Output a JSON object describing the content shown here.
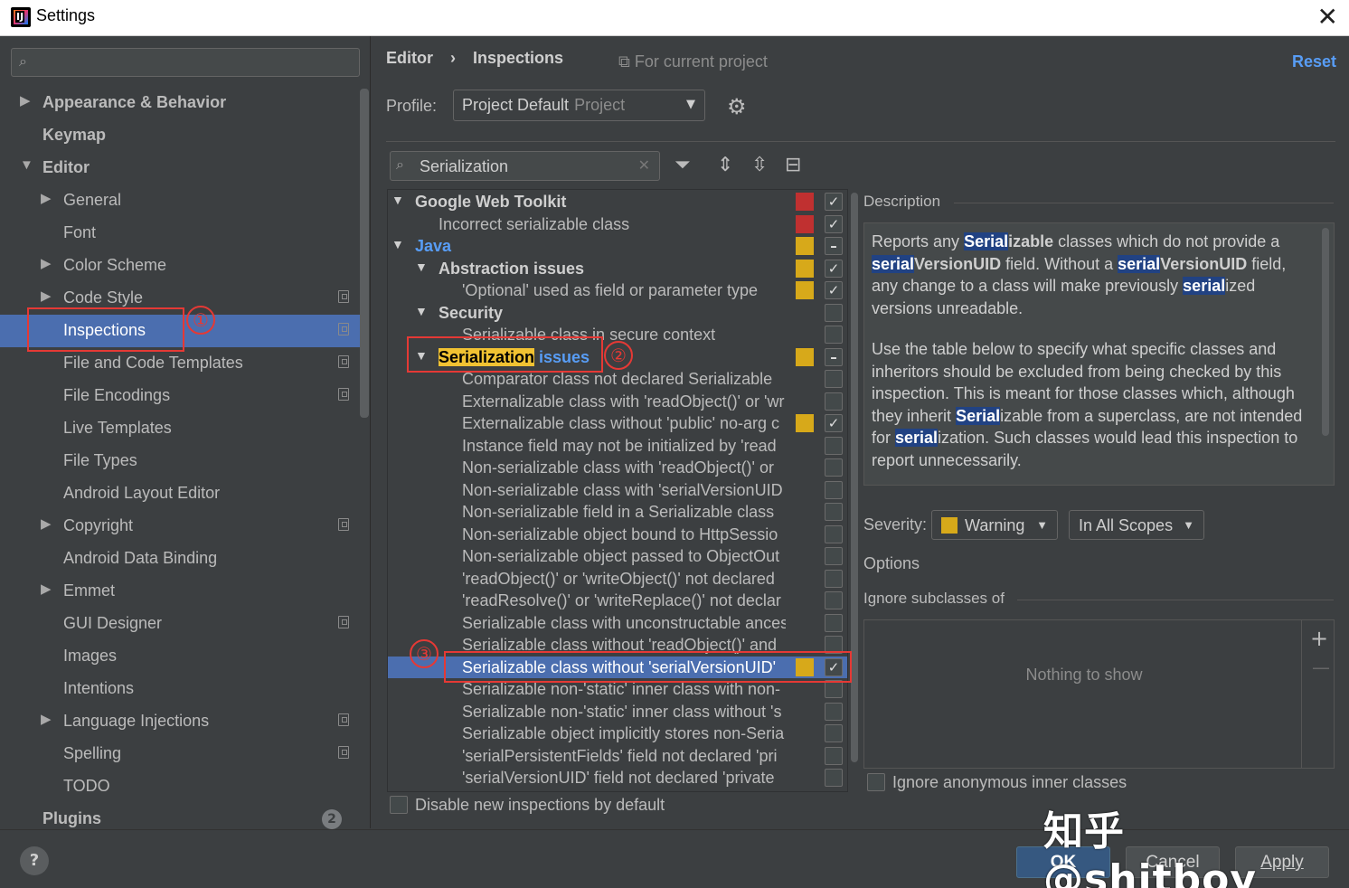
{
  "window": {
    "title": "Settings",
    "close_glyph": "✕"
  },
  "sidebar": {
    "search_placeholder": "",
    "items": [
      {
        "label": "Appearance & Behavior",
        "expanded": false,
        "bold": true
      },
      {
        "label": "Keymap",
        "bold": true
      },
      {
        "label": "Editor",
        "expanded": true,
        "bold": true
      },
      {
        "label": "General",
        "expanded": false
      },
      {
        "label": "Font"
      },
      {
        "label": "Color Scheme",
        "expanded": false
      },
      {
        "label": "Code Style",
        "expanded": false,
        "project_icon": true
      },
      {
        "label": "Inspections",
        "selected": true,
        "project_icon": true
      },
      {
        "label": "File and Code Templates",
        "project_icon": true
      },
      {
        "label": "File Encodings",
        "project_icon": true
      },
      {
        "label": "Live Templates"
      },
      {
        "label": "File Types"
      },
      {
        "label": "Android Layout Editor"
      },
      {
        "label": "Copyright",
        "expanded": false,
        "project_icon": true
      },
      {
        "label": "Android Data Binding"
      },
      {
        "label": "Emmet",
        "expanded": false
      },
      {
        "label": "GUI Designer",
        "project_icon": true
      },
      {
        "label": "Images"
      },
      {
        "label": "Intentions"
      },
      {
        "label": "Language Injections",
        "expanded": false,
        "project_icon": true
      },
      {
        "label": "Spelling",
        "project_icon": true
      },
      {
        "label": "TODO"
      },
      {
        "label": "Plugins",
        "bold": true,
        "badge": "2"
      }
    ]
  },
  "header": {
    "breadcrumb": [
      "Editor",
      "Inspections"
    ],
    "breadcrumb_sep": "›",
    "scope_note": "For current project",
    "reset": "Reset",
    "profile_label": "Profile:",
    "profile_value": "Project Default",
    "profile_kind": "Project"
  },
  "inspection_search": {
    "value": "Serialization"
  },
  "annotations": {
    "circle1": "①",
    "circle2": "②",
    "circle3": "③"
  },
  "tree": [
    {
      "label": "Google Web Toolkit",
      "level": 0,
      "group": true,
      "sev": "#c03030",
      "check": "✓"
    },
    {
      "label": "Incorrect serializable class",
      "level": 1,
      "sev": "#c03030",
      "check": "✓"
    },
    {
      "label": "Java",
      "level": 0,
      "group": true,
      "java": true,
      "sev": "#d7a91a",
      "check": "–"
    },
    {
      "label": "Abstraction issues",
      "level": 1,
      "group": true,
      "sev": "#d7a91a",
      "check": "✓"
    },
    {
      "label": "'Optional' used as field or parameter type",
      "level": 2,
      "sev": "#d7a91a",
      "check": "✓"
    },
    {
      "label": "Security",
      "level": 1,
      "group": true,
      "check": ""
    },
    {
      "label": "Serializable class in secure context",
      "level": 2,
      "check": ""
    },
    {
      "label": "Serialization issues",
      "level": 1,
      "group": true,
      "special": true,
      "sev": "#d7a91a",
      "check": "–"
    },
    {
      "label": "Comparator class not declared Serializable",
      "level": 2,
      "check": ""
    },
    {
      "label": "Externalizable class with 'readObject()' or 'wr",
      "level": 2,
      "check": ""
    },
    {
      "label": "Externalizable class without 'public' no-arg c",
      "level": 2,
      "sev": "#d7a91a",
      "check": "✓"
    },
    {
      "label": "Instance field may not be initialized by 'read",
      "level": 2,
      "check": ""
    },
    {
      "label": "Non-serializable class with 'readObject()' or",
      "level": 2,
      "check": ""
    },
    {
      "label": "Non-serializable class with 'serialVersionUID",
      "level": 2,
      "check": ""
    },
    {
      "label": "Non-serializable field in a Serializable class",
      "level": 2,
      "check": ""
    },
    {
      "label": "Non-serializable object bound to HttpSessio",
      "level": 2,
      "check": ""
    },
    {
      "label": "Non-serializable object passed to ObjectOut",
      "level": 2,
      "check": ""
    },
    {
      "label": "'readObject()' or 'writeObject()' not declared",
      "level": 2,
      "check": ""
    },
    {
      "label": "'readResolve()' or 'writeReplace()' not declar",
      "level": 2,
      "check": ""
    },
    {
      "label": "Serializable class with unconstructable ances",
      "level": 2,
      "check": ""
    },
    {
      "label": "Serializable class without 'readObject()' and",
      "level": 2,
      "check": ""
    },
    {
      "label": "Serializable class without 'serialVersionUID'",
      "level": 2,
      "selected": true,
      "sev": "#d7a91a",
      "check": "✓"
    },
    {
      "label": "Serializable non-'static' inner class with non-",
      "level": 2,
      "check": ""
    },
    {
      "label": "Serializable non-'static' inner class without 's",
      "level": 2,
      "check": ""
    },
    {
      "label": "Serializable object implicitly stores non-Seria",
      "level": 2,
      "check": ""
    },
    {
      "label": "'serialPersistentFields' field not declared 'pri",
      "level": 2,
      "check": ""
    },
    {
      "label": "'serialVersionUID' field not declared 'private",
      "level": 2,
      "check": ""
    }
  ],
  "serialization_group": {
    "highlight": "Serialization",
    "rest": " issues"
  },
  "disable_new": "Disable new inspections by default",
  "description": {
    "title": "Description",
    "p1": [
      {
        "t": "Reports any "
      },
      {
        "t": "Serial",
        "m": true
      },
      {
        "t": "izable",
        "b": true
      },
      {
        "t": " classes which do not provide a "
      },
      {
        "t": "serial",
        "m": true
      },
      {
        "t": "VersionUID",
        "b": true
      },
      {
        "t": " field. Without a "
      },
      {
        "t": "serial",
        "m": true
      },
      {
        "t": "VersionUID",
        "b": true
      },
      {
        "t": " field, any change to a class will make previously "
      },
      {
        "t": "serial",
        "m": true
      },
      {
        "t": "ized versions unreadable."
      }
    ],
    "p2": [
      {
        "t": "Use the table below to specify what specific classes and inheritors should be excluded from being checked by this inspection. This is meant for those classes which, although they inherit "
      },
      {
        "t": "Serial",
        "m": true
      },
      {
        "t": "izable from a superclass, are not intended for "
      },
      {
        "t": "serial",
        "m": true
      },
      {
        "t": "ization. Such classes would lead this inspection to report unnecessarily."
      }
    ]
  },
  "severity": {
    "label": "Severity:",
    "value": "Warning",
    "color": "#d7a91a",
    "scope": "In All Scopes"
  },
  "options": {
    "label": "Options",
    "ignore_subclasses": "Ignore subclasses of",
    "empty": "Nothing to show",
    "ignore_anonymous": "Ignore anonymous inner classes"
  },
  "buttons": {
    "help": "?",
    "ok": "OK",
    "cancel": "Cancel",
    "apply": "Apply"
  },
  "watermark": "知乎 @shitboy"
}
